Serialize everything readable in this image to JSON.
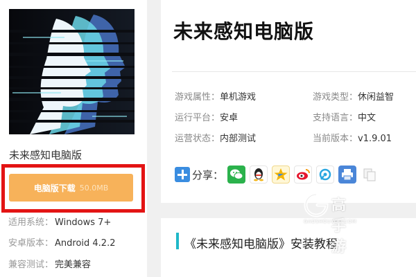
{
  "app": {
    "name": "未来感知电脑版",
    "title": "未来感知电脑版",
    "cover_icon": "glitch-face-silhouette"
  },
  "download": {
    "label": "电脑版下载",
    "size": "50.0MB",
    "button_color": "#f7b25a",
    "highlight_color": "#e31414"
  },
  "system_info": [
    {
      "label": "适用系统：",
      "value": "Windows 7+"
    },
    {
      "label": "安卓版本：",
      "value": "Android 4.2.2"
    },
    {
      "label": "兼容测试：",
      "value": "完美兼容"
    }
  ],
  "attributes": {
    "game_attr": {
      "label": "游戏属性：",
      "value": "单机游戏"
    },
    "game_type": {
      "label": "游戏类型：",
      "value": "休闲益智"
    },
    "platform": {
      "label": "运行平台：",
      "value": "安卓"
    },
    "language": {
      "label": "支持语言：",
      "value": "中文"
    },
    "status": {
      "label": "运营状态：",
      "value": "内部测试"
    },
    "version": {
      "label": "当前版本：",
      "value": "v1.9.01"
    }
  },
  "share": {
    "label": "分享：",
    "icons": [
      "wechat-icon",
      "qq-icon",
      "qzone-icon",
      "weibo-icon",
      "tencent-weibo-icon",
      "print-icon",
      "copy-icon"
    ]
  },
  "section": {
    "title": "《未来感知电脑版》安装教程",
    "accent_color": "#1fb8c8"
  },
  "watermark": {
    "text": "高手游",
    "sub": "GAOSHOUYOU.COM"
  }
}
